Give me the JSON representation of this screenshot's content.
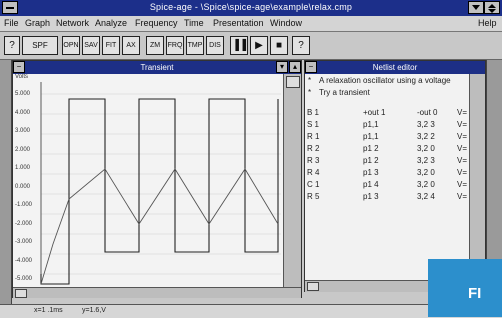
{
  "app": {
    "title": "Spice-age - \\Spice\\spice-age\\example\\relax.cmp"
  },
  "menu": [
    "File",
    "Graph",
    "Network",
    "Analyze",
    "Frequency",
    "Time",
    "Presentation",
    "Window",
    "Help"
  ],
  "toolbar": [
    "?",
    "SPF",
    "OPN",
    "SAV",
    "FIT",
    "AX",
    "ZM",
    "FRQ",
    "TMP",
    "DIS",
    "▐▐",
    "▶",
    "■",
    "?"
  ],
  "graph_window": {
    "title": "Transient",
    "y_axis_unit": "Volts",
    "y_ticks": [
      "5.000",
      "4.000",
      "3.000",
      "2.000",
      "1.000",
      "0.000",
      "-1.000",
      "-2.000",
      "-3.000",
      "-4.000",
      "-5.000"
    ]
  },
  "netlist_window": {
    "title": "Netlist editor",
    "comments": [
      "A relaxation oscillator using a voltage",
      "Try a transient"
    ],
    "rows": [
      {
        "name": "B 1",
        "n1": "+out 1",
        "n2": "-out 0",
        "v": "V="
      },
      {
        "name": "S 1",
        "n1": "p1,1",
        "n2": "3,2 3",
        "v": "V="
      },
      {
        "name": "R 1",
        "n1": "p1,1",
        "n2": "3,2 2",
        "v": "V="
      },
      {
        "name": "R 2",
        "n1": "p1 2",
        "n2": "3,2 0",
        "v": "V="
      },
      {
        "name": "R 3",
        "n1": "p1 2",
        "n2": "3,2 3",
        "v": "V="
      },
      {
        "name": "R 4",
        "n1": "p1 3",
        "n2": "3,2 0",
        "v": "V="
      },
      {
        "name": "C 1",
        "n1": "p1 4",
        "n2": "3,2 0",
        "v": "V="
      },
      {
        "name": "R 5",
        "n1": "p1 3",
        "n2": "3,2 4",
        "v": "V="
      }
    ]
  },
  "status_bar": {
    "left": "x=1 .1ms",
    "right": "y=1.6,V"
  },
  "banner": {
    "text": "FI"
  }
}
